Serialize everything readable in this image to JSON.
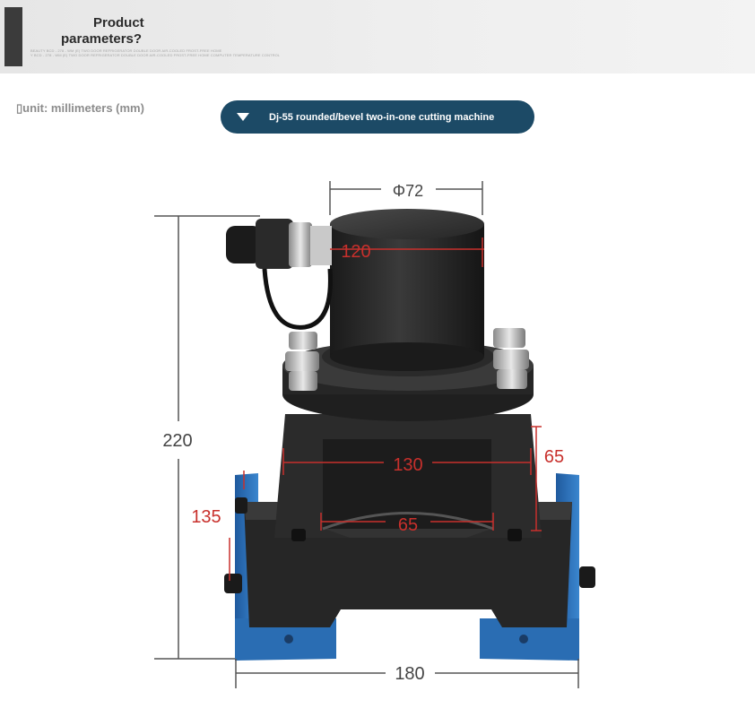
{
  "header": {
    "title_line1": "Product",
    "title_line2": "parameters?",
    "small_line1": "BEAUTY BCD - 278 - WM (E) TWO DOOR REFRIGERATOR DOUBLE DOOR AIR-COOLED FROST-FREE HOME",
    "small_line2": "Y BCD - 278 - WM (E) TWO DOOR REFRIGERATOR DOUBLE DOOR AIR-COOLED FROST-FREE HOME COMPUTER TEMPERATURE CONTROL"
  },
  "unit_label": "▯unit: millimeters (mm)",
  "model_banner": {
    "label": "Dj-55 rounded/bevel two-in-one cutting machine",
    "icon": "triangle-down-icon"
  },
  "dimensions": {
    "top_diameter": "Φ72",
    "cylinder_height": "120",
    "total_height": "220",
    "side_height": "65",
    "inner_width": "130",
    "base_depth": "135",
    "notch_width": "65",
    "base_width": "180"
  },
  "colors": {
    "banner": "#1c4a66",
    "dimension_red": "#c8302c",
    "base_blue": "#2f6fb5",
    "machine_black": "#232323"
  }
}
